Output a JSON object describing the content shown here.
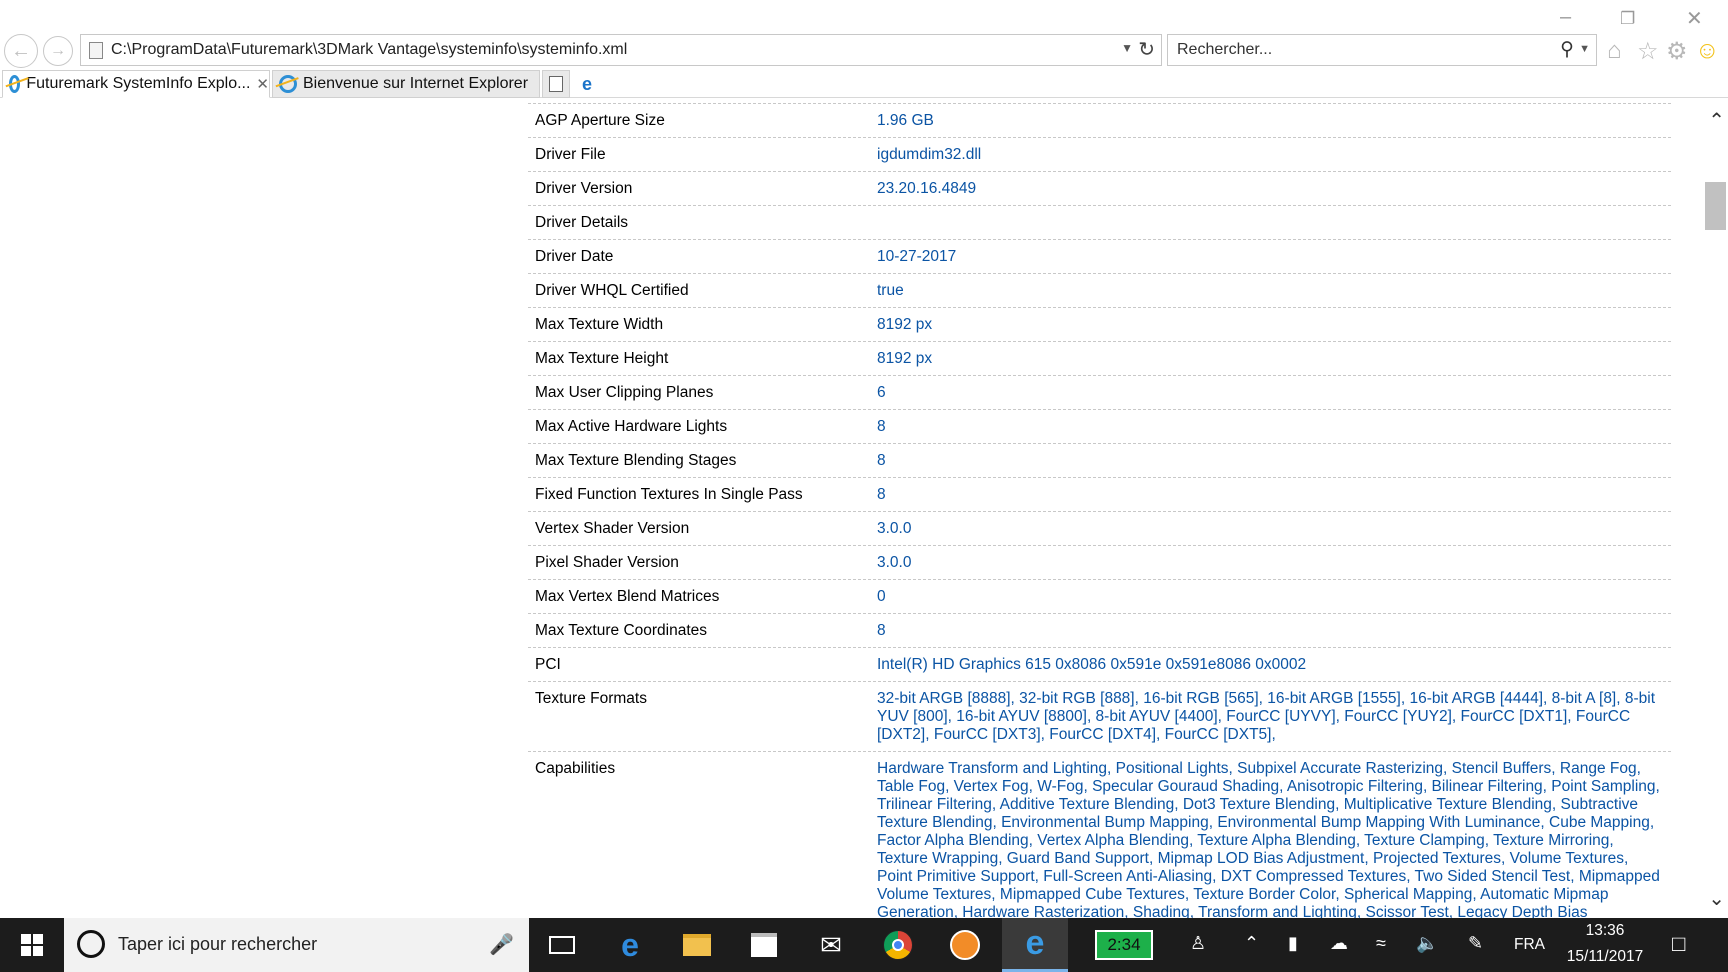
{
  "browser": {
    "address": "C:\\ProgramData\\Futuremark\\3DMark Vantage\\systeminfo\\systeminfo.xml",
    "search_placeholder": "Rechercher...",
    "tabs": [
      {
        "label": "Futuremark SystemInfo Explo...",
        "active": true
      },
      {
        "label": "Bienvenue sur Internet Explorer",
        "active": false
      }
    ]
  },
  "rows": [
    {
      "key": "AGP Aperture Size",
      "value": "1.96 GB"
    },
    {
      "key": "Driver File",
      "value": "igdumdim32.dll"
    },
    {
      "key": "Driver Version",
      "value": "23.20.16.4849"
    },
    {
      "key": "Driver Details",
      "value": ""
    },
    {
      "key": "Driver Date",
      "value": "10-27-2017"
    },
    {
      "key": "Driver WHQL Certified",
      "value": "true"
    },
    {
      "key": "Max Texture Width",
      "value": "8192 px"
    },
    {
      "key": "Max Texture Height",
      "value": "8192 px"
    },
    {
      "key": "Max User Clipping Planes",
      "value": "6"
    },
    {
      "key": "Max Active Hardware Lights",
      "value": "8"
    },
    {
      "key": "Max Texture Blending Stages",
      "value": "8"
    },
    {
      "key": "Fixed Function Textures In Single Pass",
      "value": "8"
    },
    {
      "key": "Vertex Shader Version",
      "value": "3.0.0"
    },
    {
      "key": "Pixel Shader Version",
      "value": "3.0.0"
    },
    {
      "key": "Max Vertex Blend Matrices",
      "value": "0"
    },
    {
      "key": "Max Texture Coordinates",
      "value": "8"
    },
    {
      "key": "PCI",
      "value": "Intel(R) HD Graphics 615 0x8086 0x591e 0x591e8086 0x0002"
    },
    {
      "key": "Texture Formats",
      "value": "32-bit ARGB [8888], 32-bit RGB [888], 16-bit RGB [565], 16-bit ARGB [1555], 16-bit ARGB [4444], 8-bit A [8], 8-bit YUV [800], 16-bit AYUV [8800], 8-bit AYUV [4400], FourCC [UYVY], FourCC [YUY2], FourCC [DXT1], FourCC [DXT2], FourCC [DXT3], FourCC [DXT4], FourCC [DXT5],"
    },
    {
      "key": "Capabilities",
      "value": "Hardware Transform and Lighting, Positional Lights, Subpixel Accurate Rasterizing, Stencil Buffers, Range Fog, Table Fog, Vertex Fog, W-Fog, Specular Gouraud Shading, Anisotropic Filtering, Bilinear Filtering, Point Sampling, Trilinear Filtering, Additive Texture Blending, Dot3 Texture Blending, Multiplicative Texture Blending, Subtractive Texture Blending, Environmental Bump Mapping, Environmental Bump Mapping With Luminance, Cube Mapping, Factor Alpha Blending, Vertex Alpha Blending, Texture Alpha Blending, Texture Clamping, Texture Mirroring, Texture Wrapping, Guard Band Support, Mipmap LOD Bias Adjustment, Projected Textures, Volume Textures, Point Primitive Support, Full-Screen Anti-Aliasing, DXT Compressed Textures, Two Sided Stencil Test, Mipmapped Volume Textures, Mipmapped Cube Textures, Texture Border Color, Spherical Mapping, Automatic Mipmap Generation, Hardware Rasterization, Shading, Transform and Lighting, Scissor Test, Legacy Depth Bias"
    }
  ],
  "taskbar": {
    "search_placeholder": "Taper ici pour rechercher",
    "battery_app_time": "2:34",
    "language": "FRA",
    "time": "13:36",
    "date": "15/11/2017"
  }
}
